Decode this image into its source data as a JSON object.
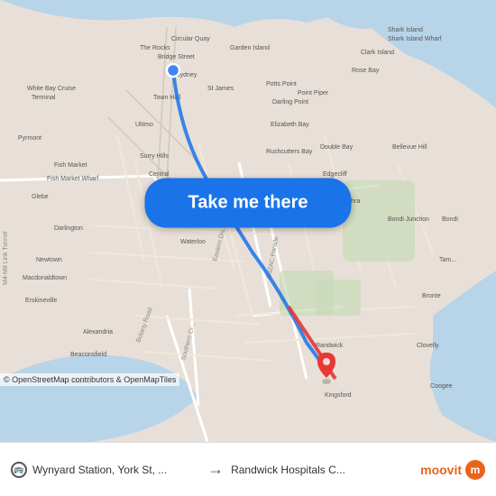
{
  "map": {
    "background_color": "#e8e0d8",
    "origin_label": "Wynyard Station, York St, ...",
    "destination_label": "Randwick Hospitals C...",
    "route_color": "#1a73e8",
    "attribution": "© OpenStreetMap contributors & OpenMapTiles"
  },
  "button": {
    "label": "Take me there",
    "color": "#1a73e8"
  },
  "bottom_bar": {
    "origin": "Wynyard Station, York St, ...",
    "destination": "Randwick Hospitals C...",
    "logo": "moovit"
  }
}
